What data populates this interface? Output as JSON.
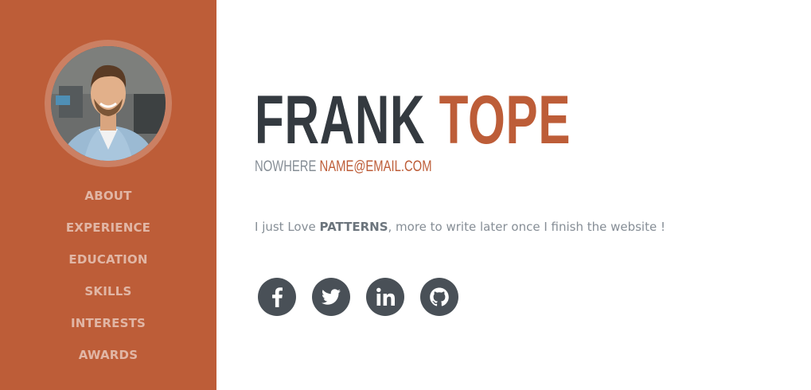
{
  "colors": {
    "primary": "#bd5d38",
    "dark": "#343a40",
    "muted": "#868e96",
    "social_bg": "#495057"
  },
  "sidebar": {
    "avatar_icon": "profile-photo",
    "nav": [
      {
        "label": "ABOUT"
      },
      {
        "label": "EXPERIENCE"
      },
      {
        "label": "EDUCATION"
      },
      {
        "label": "SKILLS"
      },
      {
        "label": "INTERESTS"
      },
      {
        "label": "AWARDS"
      }
    ]
  },
  "about": {
    "first_name": "FRANK",
    "last_name": "TOPE",
    "location": "NOWHERE",
    "email": "NAME@EMAIL.COM",
    "lead_before": "I just Love ",
    "lead_bold": "PATTERNS",
    "lead_after": ", more to write later once I finish the website !",
    "social": [
      {
        "icon": "facebook-icon"
      },
      {
        "icon": "twitter-icon"
      },
      {
        "icon": "linkedin-icon"
      },
      {
        "icon": "github-icon"
      }
    ]
  }
}
